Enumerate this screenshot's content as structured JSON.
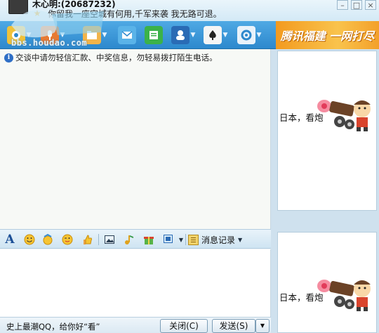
{
  "header": {
    "contact_name": "木心明:(20687232)",
    "signature": "你留我一座空城有何用,千军来袭   我无路可退。"
  },
  "watermark": {
    "url": "bbs.houdao.com"
  },
  "toolbar": {
    "buttons": [
      {
        "icon": "video-chat-icon"
      },
      {
        "icon": "voice-chat-icon"
      },
      {
        "icon": "send-file-icon"
      },
      {
        "icon": "send-mail-icon"
      },
      {
        "icon": "sms-icon"
      },
      {
        "icon": "qq-group-icon"
      },
      {
        "icon": "game-icon"
      },
      {
        "icon": "settings-icon"
      }
    ],
    "ad_banner": "腾讯福建 一网打尽"
  },
  "messages": {
    "notice": "交谈中请勿轻信汇款、中奖信息，勿轻易拨打陌生电话。"
  },
  "format_toolbar": {
    "items": [
      "font-icon",
      "emoticon-icon",
      "magic-expression-icon",
      "wink-icon",
      "thumbs-icon",
      "screenshot-icon",
      "music-icon",
      "gift-icon",
      "capture-icon"
    ],
    "history_label": "消息记录"
  },
  "bottom": {
    "ad_text": "史上最潮QQ，给你好“看”",
    "close_label": "关闭(C)",
    "send_label": "发送(S)"
  },
  "show_panel": {
    "caption_top": "日本，看炮",
    "caption_bottom": "日本，看炮"
  },
  "colors": {
    "toolbar": "#2d88cd",
    "ad_banner": "#f39a1f",
    "info_icon": "#2f6fc6"
  }
}
